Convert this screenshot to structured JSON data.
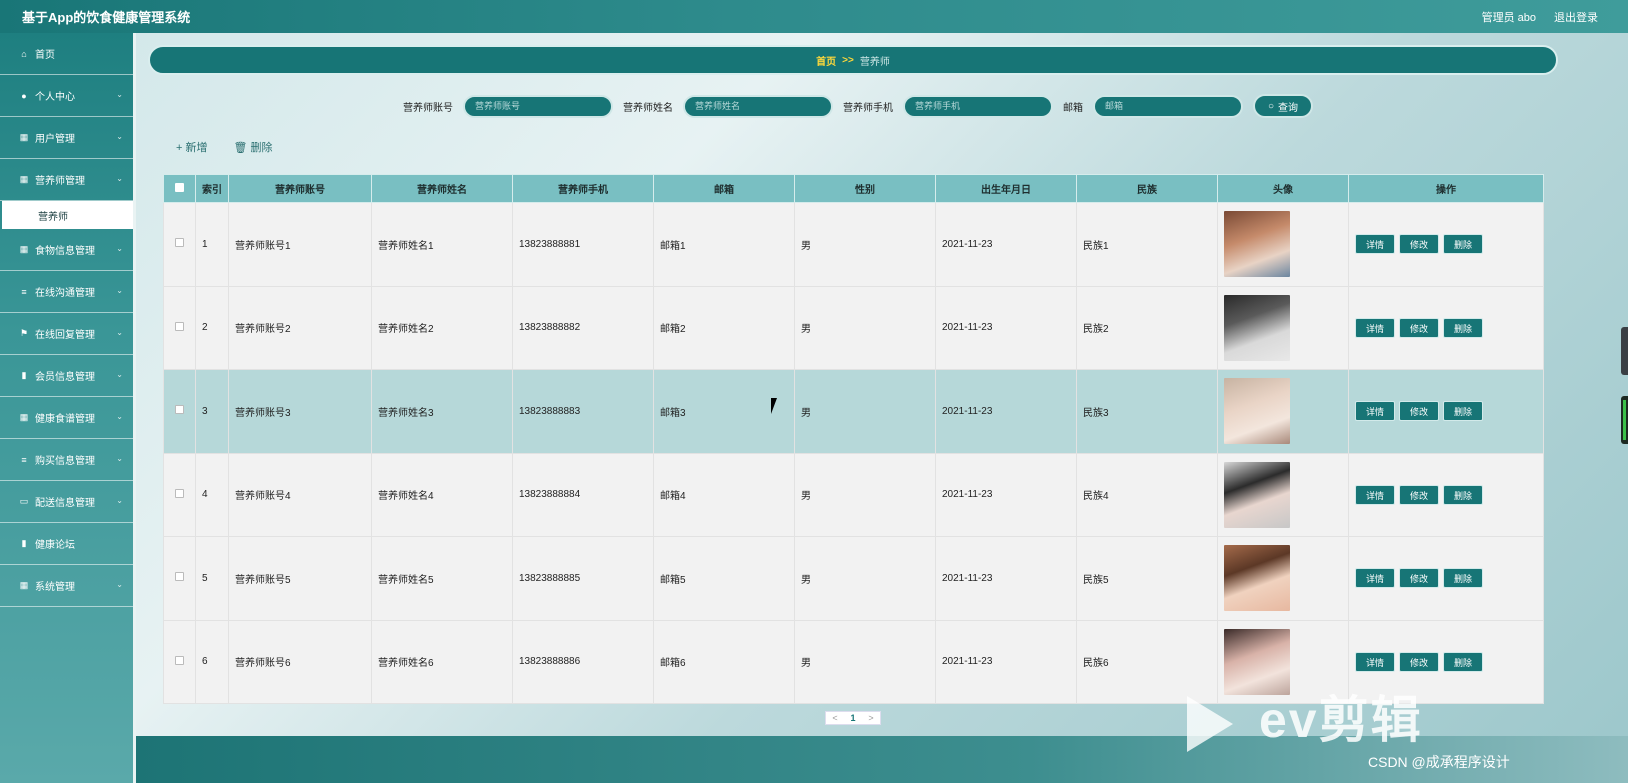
{
  "app": {
    "title": "基于App的饮食健康管理系统"
  },
  "header": {
    "user": "管理员 abo",
    "logout": "退出登录"
  },
  "sidebar": {
    "items": [
      {
        "label": "首页",
        "icon": "home-icon",
        "glyph": "⌂",
        "chevron": false
      },
      {
        "label": "个人中心",
        "icon": "user-icon",
        "glyph": "●",
        "chevron": true
      },
      {
        "label": "用户管理",
        "icon": "users-icon",
        "glyph": "▦",
        "chevron": true
      },
      {
        "label": "营养师管理",
        "icon": "grid-icon",
        "glyph": "▦",
        "chevron": true
      },
      {
        "label": "食物信息管理",
        "icon": "grid-icon",
        "glyph": "▦",
        "chevron": true
      },
      {
        "label": "在线沟通管理",
        "icon": "sliders-icon",
        "glyph": "≡",
        "chevron": true
      },
      {
        "label": "在线回复管理",
        "icon": "flag-icon",
        "glyph": "⚑",
        "chevron": true
      },
      {
        "label": "会员信息管理",
        "icon": "chart-icon",
        "glyph": "▮",
        "chevron": true
      },
      {
        "label": "健康食谱管理",
        "icon": "grid-icon",
        "glyph": "▦",
        "chevron": true
      },
      {
        "label": "购买信息管理",
        "icon": "list-icon",
        "glyph": "≡",
        "chevron": true
      },
      {
        "label": "配送信息管理",
        "icon": "briefcase-icon",
        "glyph": "▭",
        "chevron": true
      },
      {
        "label": "健康论坛",
        "icon": "doc-icon",
        "glyph": "▮",
        "chevron": false
      },
      {
        "label": "系统管理",
        "icon": "grid-icon",
        "glyph": "▦",
        "chevron": true
      }
    ],
    "active_sub": "营养师"
  },
  "breadcrumb": {
    "home": "首页",
    "sep": ">>",
    "current": "营养师"
  },
  "search": {
    "fields": [
      {
        "label": "营养师账号",
        "placeholder": "营养师账号"
      },
      {
        "label": "营养师姓名",
        "placeholder": "营养师姓名"
      },
      {
        "label": "营养师手机",
        "placeholder": "营养师手机"
      },
      {
        "label": "邮箱",
        "placeholder": "邮箱"
      }
    ],
    "button": "查询"
  },
  "actions": {
    "add": "+ 新增",
    "delete": "🗑 删除"
  },
  "table": {
    "columns": [
      "索引",
      "营养师账号",
      "营养师姓名",
      "营养师手机",
      "邮箱",
      "性别",
      "出生年月日",
      "民族",
      "头像",
      "操作"
    ],
    "rows": [
      {
        "index": "1",
        "account": "营养师账号1",
        "name": "营养师姓名1",
        "phone": "13823888881",
        "email": "邮箱1",
        "gender": "男",
        "birthday": "2021-11-23",
        "ethnicity": "民族1"
      },
      {
        "index": "2",
        "account": "营养师账号2",
        "name": "营养师姓名2",
        "phone": "13823888882",
        "email": "邮箱2",
        "gender": "男",
        "birthday": "2021-11-23",
        "ethnicity": "民族2"
      },
      {
        "index": "3",
        "account": "营养师账号3",
        "name": "营养师姓名3",
        "phone": "13823888883",
        "email": "邮箱3",
        "gender": "男",
        "birthday": "2021-11-23",
        "ethnicity": "民族3"
      },
      {
        "index": "4",
        "account": "营养师账号4",
        "name": "营养师姓名4",
        "phone": "13823888884",
        "email": "邮箱4",
        "gender": "男",
        "birthday": "2021-11-23",
        "ethnicity": "民族4"
      },
      {
        "index": "5",
        "account": "营养师账号5",
        "name": "营养师姓名5",
        "phone": "13823888885",
        "email": "邮箱5",
        "gender": "男",
        "birthday": "2021-11-23",
        "ethnicity": "民族5"
      },
      {
        "index": "6",
        "account": "营养师账号6",
        "name": "营养师姓名6",
        "phone": "13823888886",
        "email": "邮箱6",
        "gender": "男",
        "birthday": "2021-11-23",
        "ethnicity": "民族6"
      }
    ],
    "row_actions": {
      "detail": "详情",
      "edit": "修改",
      "delete": "删除"
    }
  },
  "pagination": {
    "prev": "<",
    "current": "1",
    "next": ">"
  },
  "watermark": {
    "ev": "ev剪辑",
    "csdn": "CSDN @成承程序设计"
  },
  "colors": {
    "accent": "#177576",
    "header_bg": "#79bfc2",
    "breadcrumb_home": "#ffd83a"
  }
}
